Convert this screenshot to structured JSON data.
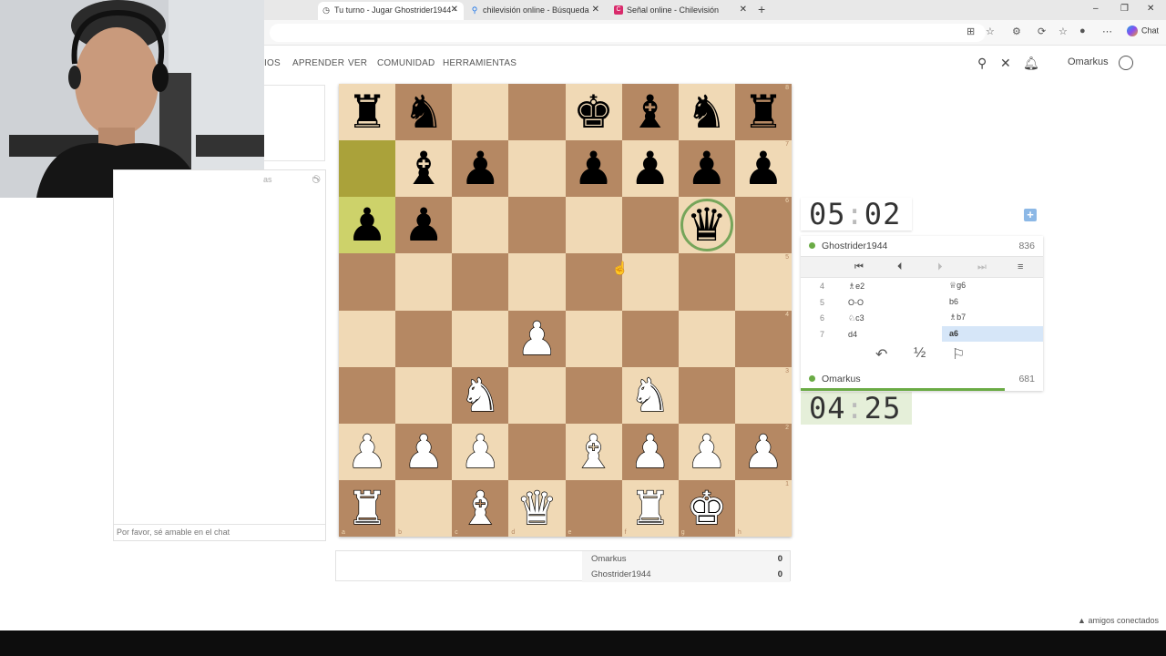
{
  "browser": {
    "tabs": [
      {
        "label": "Tu turno - Jugar Ghostrider1944 ·",
        "icon": "history-icon"
      },
      {
        "label": "chilevisión online - Búsqueda",
        "icon": "search-icon"
      },
      {
        "label": "Señal online - Chilevisión",
        "icon": "chilevision-icon"
      }
    ],
    "chat_button": "Chat"
  },
  "nav": {
    "items": [
      "IOS",
      "APRENDER",
      "VER",
      "COMUNIDAD",
      "HERRAMIENTAS"
    ],
    "username": "Omarkus"
  },
  "chat": {
    "header_label": "as",
    "placeholder": "Por favor, sé amable en el chat"
  },
  "board": {
    "ranks": [
      "8",
      "7",
      "6",
      "5",
      "4",
      "3",
      "2",
      "1"
    ],
    "files": [
      "a",
      "b",
      "c",
      "d",
      "e",
      "f",
      "g",
      "h"
    ],
    "position": [
      [
        "bR",
        "bN",
        "",
        "",
        "bK",
        "bB",
        "bN",
        "bR"
      ],
      [
        "",
        "bB",
        "bP",
        "",
        "bP",
        "bP",
        "bP",
        "bP"
      ],
      [
        "bP",
        "bP",
        "",
        "",
        "",
        "",
        "bQ",
        ""
      ],
      [
        "",
        "",
        "",
        "",
        "",
        "",
        "",
        ""
      ],
      [
        "",
        "",
        "",
        "wP",
        "",
        "",
        "",
        ""
      ],
      [
        "",
        "",
        "wN",
        "",
        "",
        "wN",
        "",
        ""
      ],
      [
        "wP",
        "wP",
        "wP",
        "",
        "wB",
        "wP",
        "wP",
        "wP"
      ],
      [
        "wR",
        "",
        "wB",
        "wQ",
        "",
        "wR",
        "wK",
        ""
      ]
    ],
    "last_move": [
      "a7",
      "a6"
    ],
    "highlight_square": "g6"
  },
  "scores": [
    {
      "name": "Omarkus",
      "points": "0"
    },
    {
      "name": "Ghostrider1944",
      "points": "0"
    }
  ],
  "clocks": {
    "top": {
      "min": "05",
      "sec": "02"
    },
    "bottom": {
      "min": "04",
      "sec": "25"
    }
  },
  "opponent": {
    "name": "Ghostrider1944",
    "rating": "836"
  },
  "player": {
    "name": "Omarkus",
    "rating": "681"
  },
  "moves": [
    {
      "no": "4",
      "white": "♗e2",
      "black": "♕g6"
    },
    {
      "no": "5",
      "white": "O-O",
      "black": "b6"
    },
    {
      "no": "6",
      "white": "♘c3",
      "black": "♗b7"
    },
    {
      "no": "7",
      "white": "d4",
      "black": "a6"
    }
  ],
  "footer": {
    "friends": "▲ amigos conectados"
  },
  "colors": {
    "light_square": "#f0d9b5",
    "dark_square": "#b58863",
    "online": "#6aab45",
    "current_move": "#d6e6f8"
  }
}
